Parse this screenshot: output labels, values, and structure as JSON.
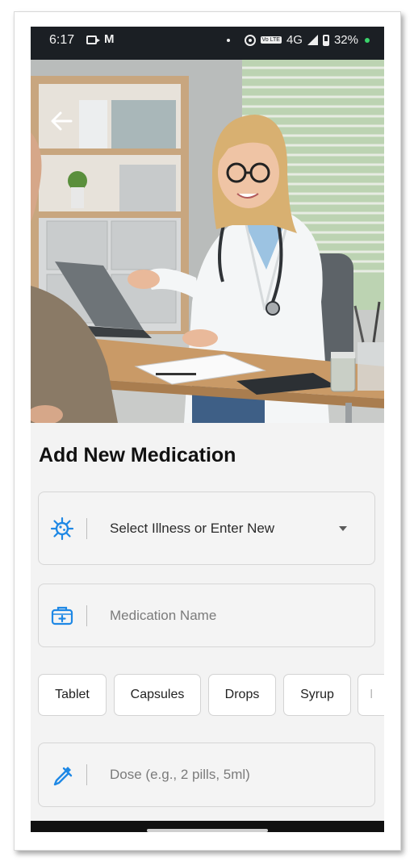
{
  "status_bar": {
    "time": "6:17",
    "gmail_glyph": "M",
    "volte": "Vo LTE",
    "network": "4G",
    "battery": "32%",
    "icons": [
      "video-camera-icon",
      "gmail-icon",
      "hotspot-icon",
      "volte-icon",
      "signal-icon",
      "battery-icon"
    ]
  },
  "hero": {
    "back_icon": "arrow-left-icon",
    "image_subject": "doctor-consultation-illustration"
  },
  "form": {
    "title": "Add New Medication",
    "illness": {
      "icon": "virus-icon",
      "value": "Select Illness or Enter New",
      "dropdown_icon": "caret-down-icon"
    },
    "medication_name": {
      "icon": "medical-kit-icon",
      "placeholder": "Medication Name"
    },
    "forms": [
      "Tablet",
      "Capsules",
      "Drops",
      "Syrup",
      "I"
    ],
    "dose": {
      "icon": "dropper-icon",
      "placeholder": "Dose (e.g., 2 pills, 5ml)"
    }
  },
  "colors": {
    "accent": "#1e88e5",
    "status_bar": "#1b1f24",
    "background": "#f3f3f3"
  }
}
